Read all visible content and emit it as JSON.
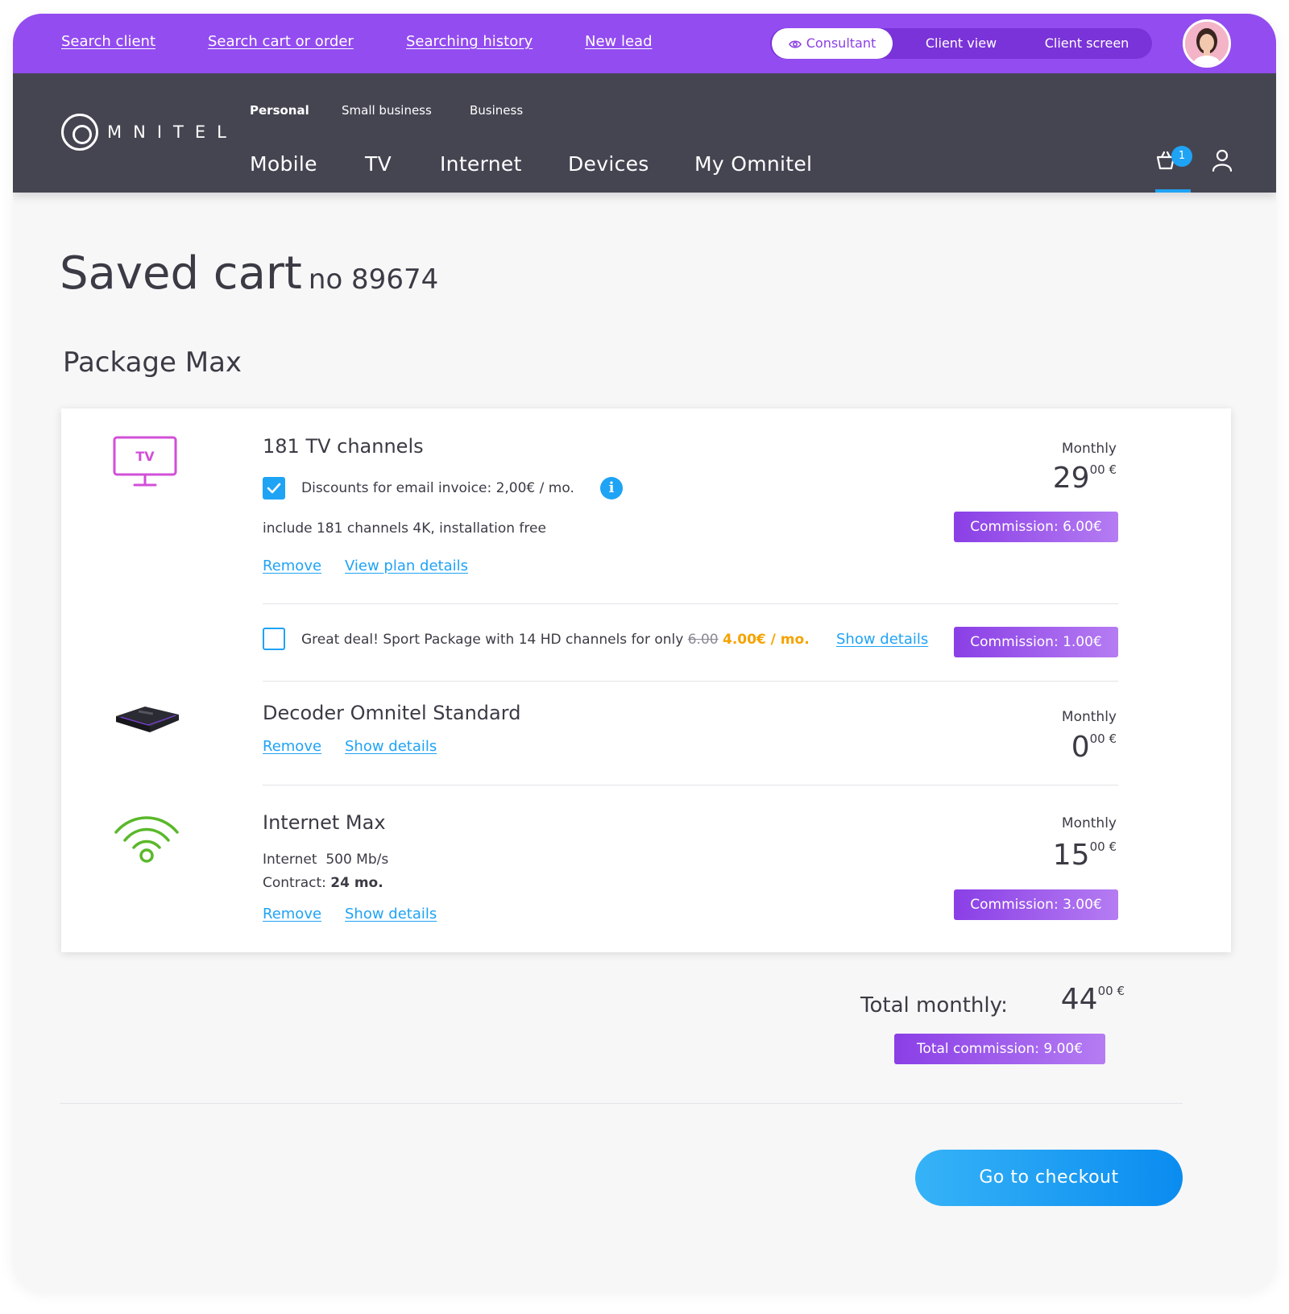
{
  "topbar": {
    "links": [
      "Search client",
      "Search cart or order",
      "Searching history",
      "New lead"
    ],
    "view_modes": [
      "Consultant",
      "Client view",
      "Client screen"
    ],
    "active_view": "Consultant"
  },
  "nav": {
    "logo": "MNITEL",
    "segments": [
      "Personal",
      "Small business",
      "Business"
    ],
    "active_segment": "Personal",
    "main": [
      "Mobile",
      "TV",
      "Internet",
      "Devices",
      "My Omnitel"
    ],
    "cart_count": "1"
  },
  "page": {
    "title": "Saved cart",
    "cart_no": "no 89674",
    "package_title": "Package Max"
  },
  "items": {
    "tv": {
      "icon_label": "TV",
      "title": "181 TV channels",
      "discount_label": "Discounts for email invoice: 2,00€ / mo.",
      "discount_checked": true,
      "info_glyph": "i",
      "description": "include 181 channels 4K, installation free",
      "remove": "Remove",
      "details": "View plan details",
      "monthly_label": "Monthly",
      "price_int": "29",
      "price_sup": "00 €",
      "commission": "Commission: 6.00€"
    },
    "sport": {
      "checked": false,
      "text": "Great deal! Sport Package with 14 HD channels for only",
      "old_price": "6.00",
      "new_price": "4.00€ / mo.",
      "details": "Show details",
      "commission": "Commission: 1.00€"
    },
    "decoder": {
      "title": "Decoder Omnitel Standard",
      "remove": "Remove",
      "details": "Show details",
      "monthly_label": "Monthly",
      "price_int": "0",
      "price_sup": "00 €"
    },
    "internet": {
      "title": "Internet Max",
      "speed_label": "Internet",
      "speed_value": "500 Mb/s",
      "contract_label": "Contract:",
      "contract_value": "24 mo.",
      "remove": "Remove",
      "details": "Show details",
      "monthly_label": "Monthly",
      "price_int": "15",
      "price_sup": "00 €",
      "commission": "Commission: 3.00€"
    }
  },
  "totals": {
    "label": "Total monthly:",
    "price_int": "44",
    "price_sup": "00 €",
    "commission": "Total commission: 9.00€"
  },
  "checkout_label": "Go to checkout",
  "colors": {
    "topbar": "#934cf0",
    "nav": "#454552",
    "accent": "#1fa3f5",
    "commission": "#8a3fe6",
    "deal": "#f5a300"
  }
}
